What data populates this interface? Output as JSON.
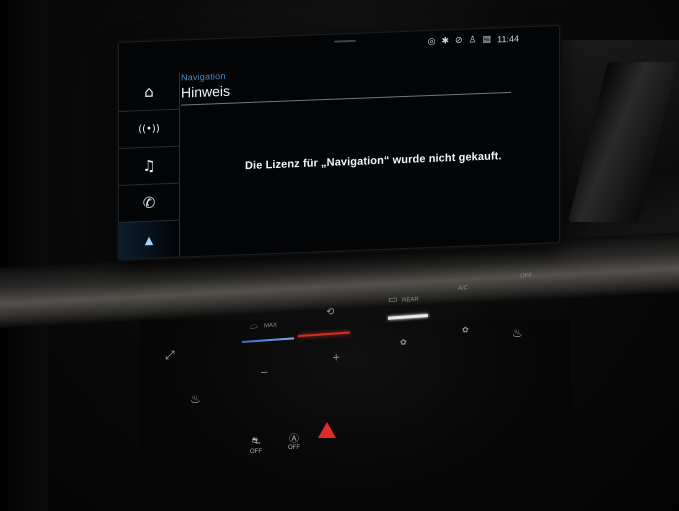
{
  "status_bar": {
    "icons": [
      "location-icon",
      "bluetooth-icon",
      "signal-off-icon",
      "person-icon",
      "sim-icon"
    ],
    "time": "11:44"
  },
  "sidebar": {
    "items": [
      {
        "name": "home",
        "icon": "home-icon",
        "glyph": "⌂",
        "active": false
      },
      {
        "name": "radio",
        "icon": "radio-icon",
        "glyph": "((•))",
        "active": false
      },
      {
        "name": "media",
        "icon": "music-note-icon",
        "glyph": "♫",
        "active": false
      },
      {
        "name": "phone",
        "icon": "phone-icon",
        "glyph": "✆",
        "active": false
      },
      {
        "name": "navigation",
        "icon": "navigation-arrow-icon",
        "glyph": "▲",
        "active": true
      }
    ]
  },
  "header": {
    "section": "Navigation",
    "title": "Hinweis"
  },
  "message": "Die Lizenz für „Navigation“ wurde nicht gekauft.",
  "climate": {
    "max_label": "MAX",
    "rear_label": "REAR",
    "ac_label": "A/C",
    "off_label": "OFF",
    "minus": "−",
    "plus": "+"
  },
  "bottom_buttons": {
    "esc_off": "OFF",
    "auto_off": "OFF"
  },
  "colors": {
    "accent": "#4f8ec4",
    "hazard": "#e02b26",
    "temp_red": "#d03020"
  }
}
